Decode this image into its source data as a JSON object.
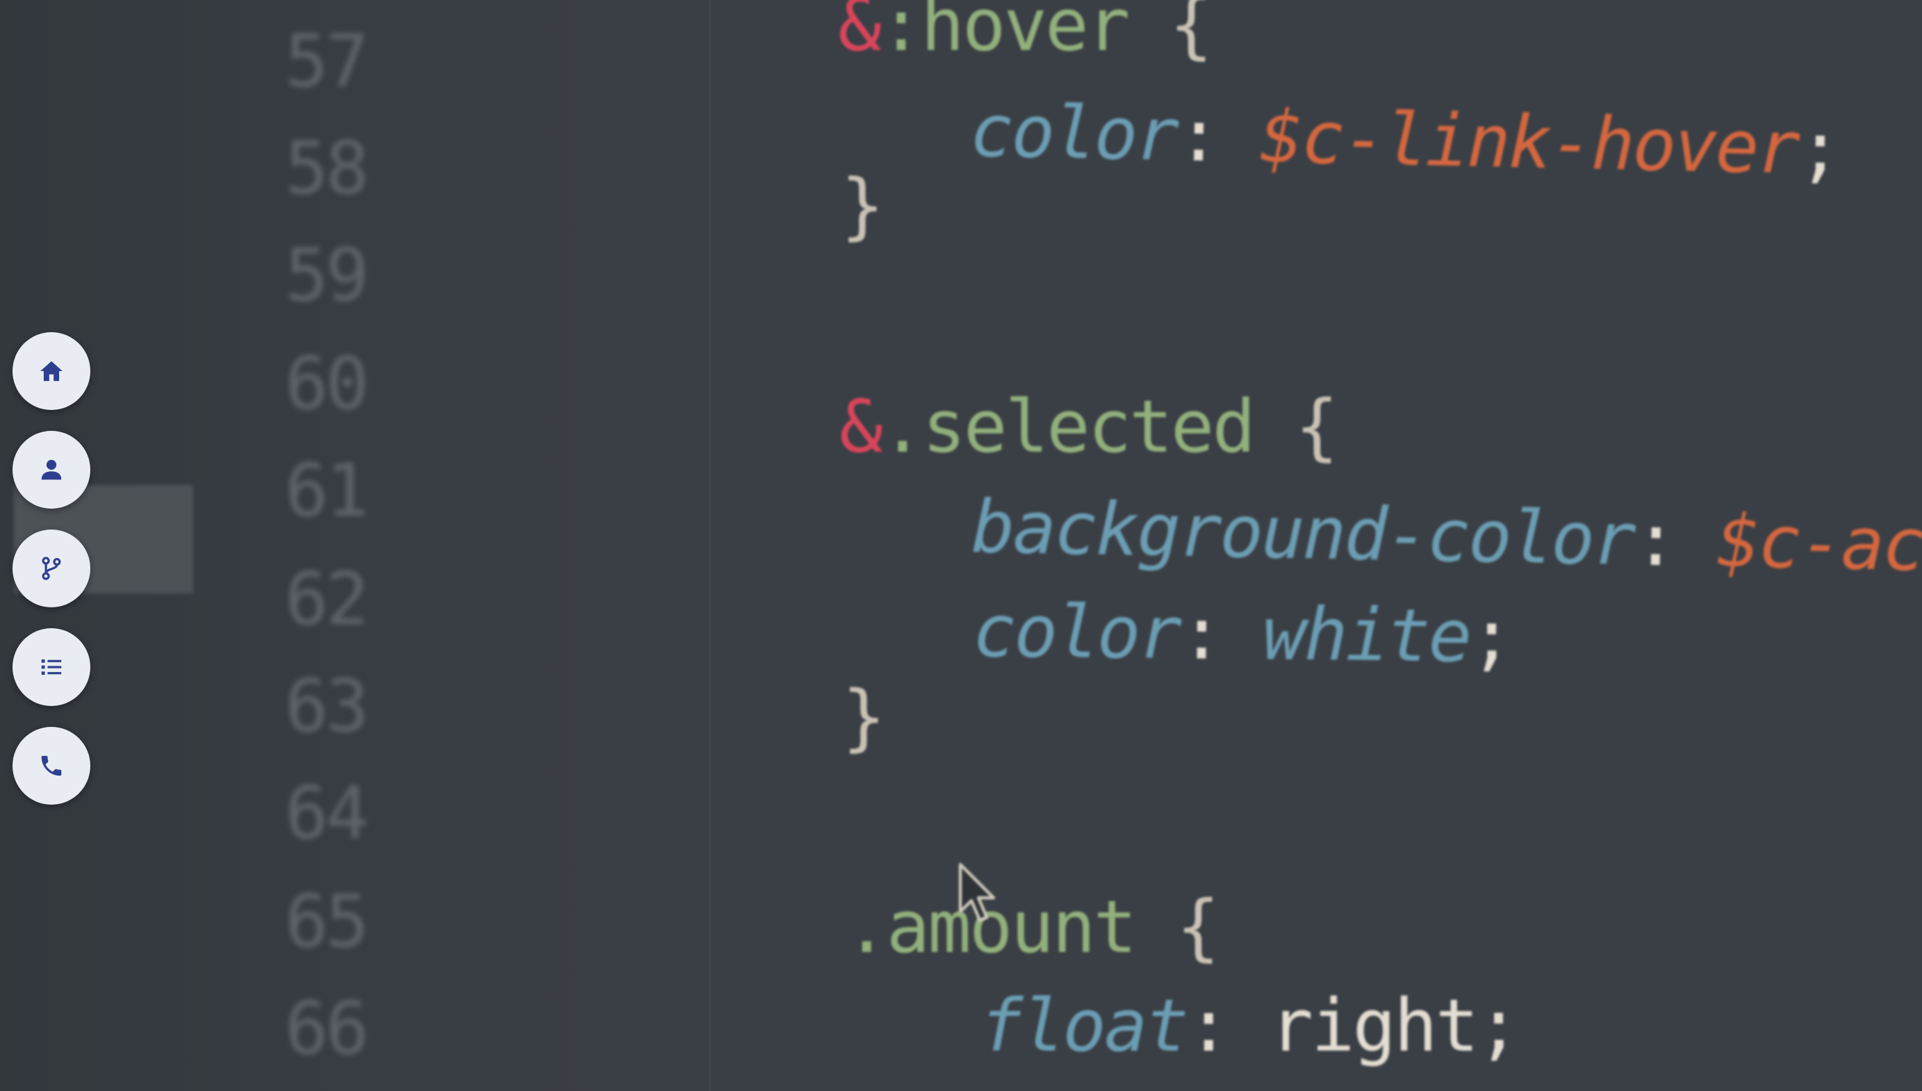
{
  "editor": {
    "line_numbers": [
      "57",
      "58",
      "59",
      "60",
      "61",
      "62",
      "63",
      "64",
      "65",
      "66"
    ],
    "lines": {
      "l57_amp": "&",
      "l57_sel": ":hover",
      "l57_brace": " {",
      "l58_prop": "color",
      "l58_colon": ":",
      "l58_val": "$c-link-hover",
      "l58_semi": ";",
      "l59_brace": "}",
      "l61_amp": "&",
      "l61_sel": ".selected",
      "l61_brace": " {",
      "l62_prop": "background-color",
      "l62_colon": ":",
      "l62_val": "$c-action",
      "l62_semi": ";",
      "l63_prop": "color",
      "l63_colon": ":",
      "l63_val": "white",
      "l63_semi": ";",
      "l64_brace": "}",
      "l66_sel": ".amount",
      "l66_brace": " {",
      "l67_prop": "float",
      "l67_colon": ":",
      "l67_val": "right",
      "l67_semi": ";"
    }
  },
  "nav": {
    "items": [
      {
        "icon": "home-icon"
      },
      {
        "icon": "user-icon"
      },
      {
        "icon": "git-branch-icon"
      },
      {
        "icon": "list-icon"
      },
      {
        "icon": "phone-icon"
      }
    ],
    "icon_color": "#2e3f8f",
    "button_color": "#e9ecf2"
  },
  "colors": {
    "background": "#3a3f45",
    "ampersand": "#d9455b",
    "selector": "#92b07c",
    "property": "#6b9db3",
    "variable": "#d4673f"
  }
}
